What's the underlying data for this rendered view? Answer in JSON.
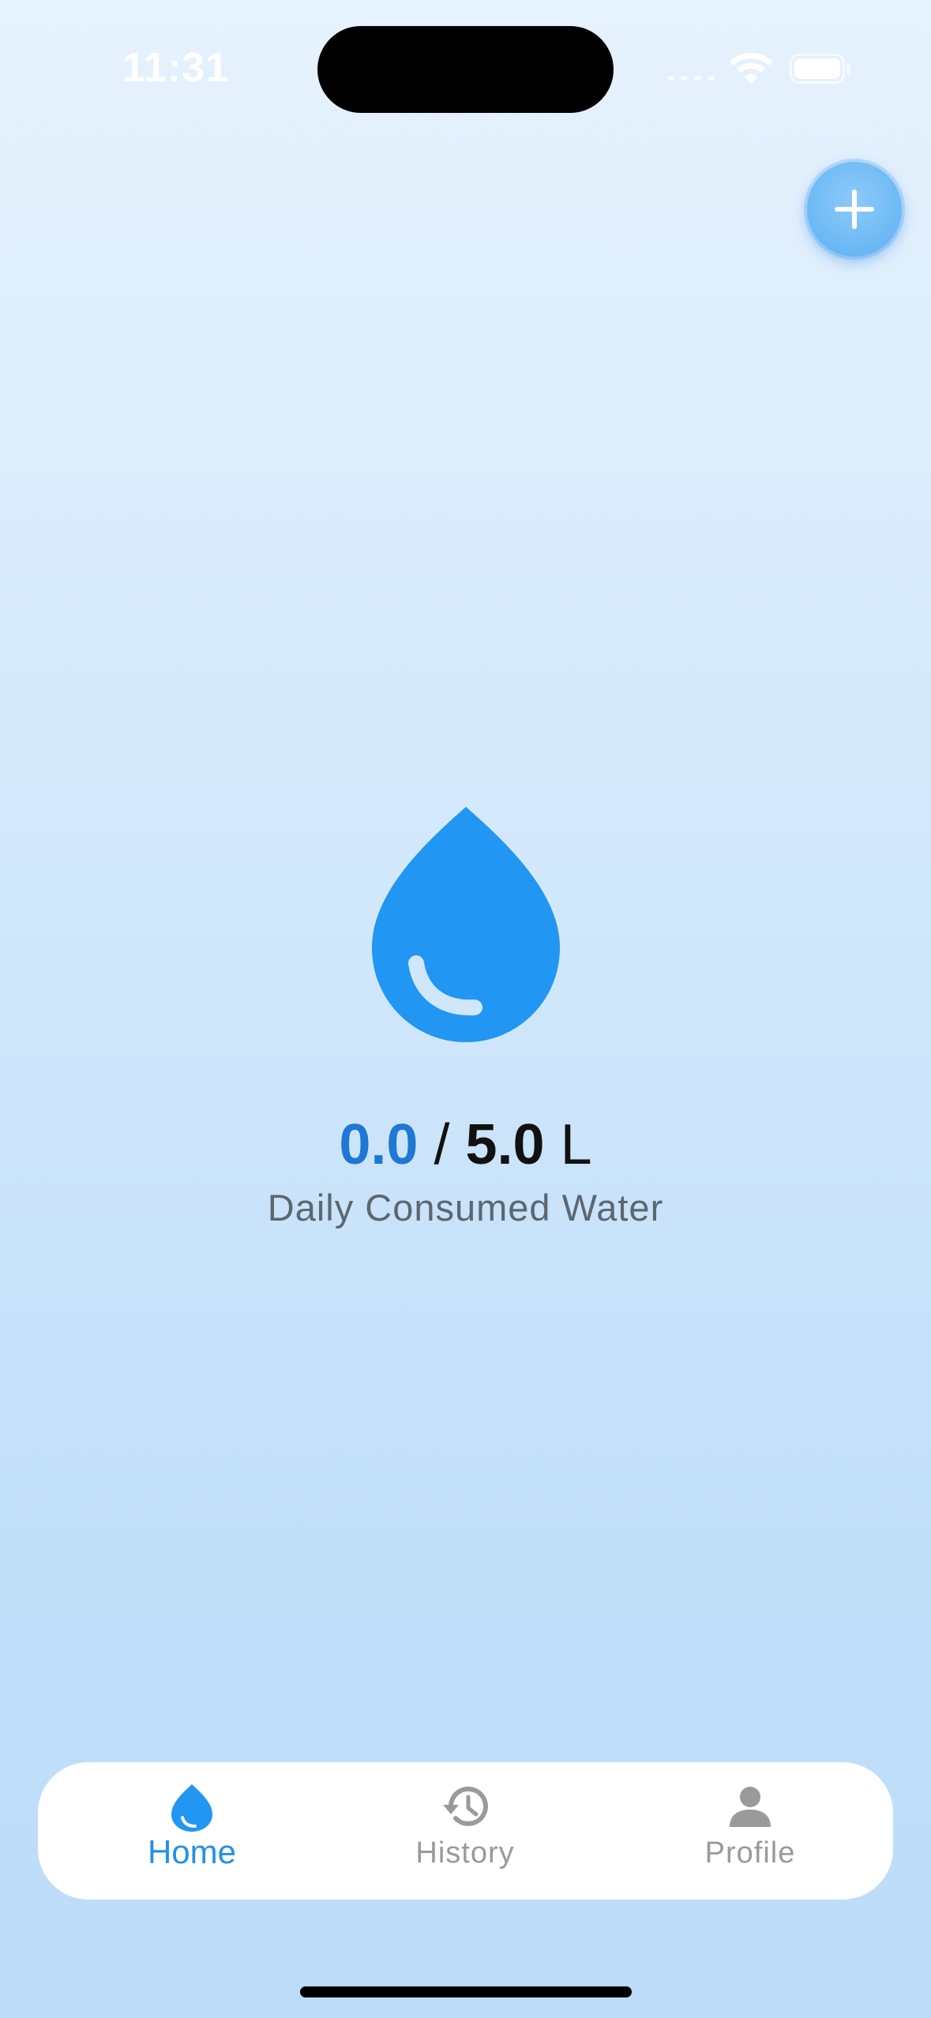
{
  "status_bar": {
    "time": "11:31"
  },
  "colors": {
    "accent": "#2196F3",
    "consumed_text": "#1e78d4",
    "inactive_tab": "#9a9a9a",
    "subtitle": "#5c6770"
  },
  "add_button": {
    "icon": "plus-icon"
  },
  "main": {
    "icon": "water-drop-icon",
    "consumed": "0.0",
    "separator": "/",
    "goal": "5.0",
    "unit": "L",
    "subtitle": "Daily Consumed Water"
  },
  "tabs": [
    {
      "label": "Home",
      "icon": "water-drop-icon",
      "active": true
    },
    {
      "label": "History",
      "icon": "history-icon",
      "active": false
    },
    {
      "label": "Profile",
      "icon": "person-icon",
      "active": false
    }
  ]
}
